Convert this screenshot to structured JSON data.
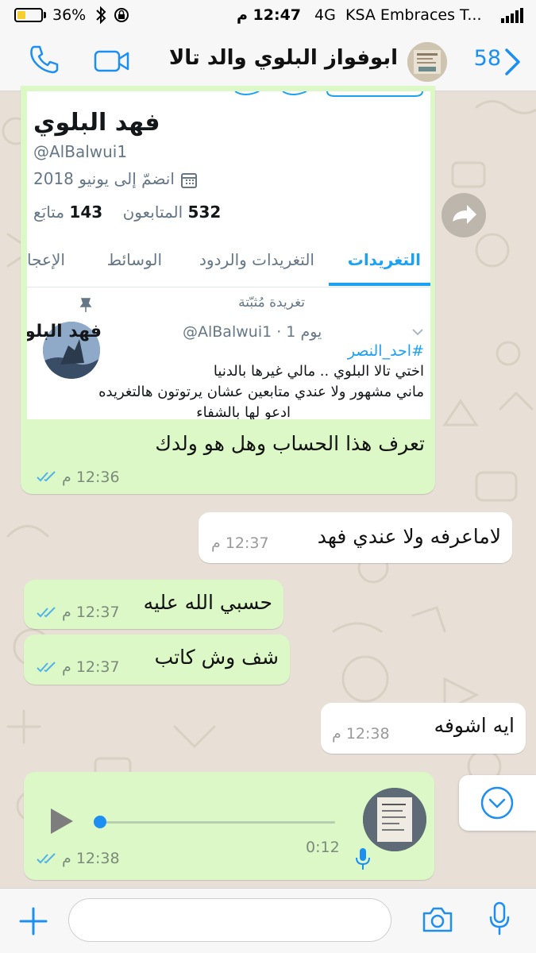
{
  "status_bar": {
    "battery_percent": "36%",
    "battery_level": 0.36,
    "time": "12:47 م",
    "network": "4G",
    "carrier": "KSA Embraces T..."
  },
  "header": {
    "unread_count": "58",
    "contact_name": "ابوفواز البلوي والد تالا"
  },
  "profile_card": {
    "name": "فهد البلوي",
    "handle": "@AlBalwui1",
    "joined": "انضمّ إلى يونيو 2018",
    "followers_count": "532",
    "followers_label": "المتابعون",
    "following_count": "143",
    "following_label": "متابَع",
    "tabs": [
      "التغريدات",
      "التغريدات والردود",
      "الوسائط",
      "الإعجا"
    ],
    "active_tab": 0,
    "pinned_label": "تغريدة مُثبّتة",
    "tweet": {
      "author": "فهد البلوي",
      "handle_time": "@AlBalwui1 · 1 يوم",
      "hashtag": "#احد_النصر",
      "line1": "اختي تالا البلوي .. مالي غيرها بالدنيا",
      "line2": "ماني مشهور ولا عندي متابعين عشان يرتوتون هالتغريده",
      "line3": "ادعو لها بالشفاء"
    }
  },
  "messages": [
    {
      "direction": "out",
      "text": "تعرف هذا الحساب وهل هو ولدك",
      "time": "12:36 م"
    },
    {
      "direction": "in",
      "text": "لاماعرفه ولا عندي فهد",
      "time": "12:37 م"
    },
    {
      "direction": "out",
      "text": "حسبي الله عليه",
      "time": "12:37 م"
    },
    {
      "direction": "out",
      "text": "شف وش كاتب",
      "time": "12:37 م"
    },
    {
      "direction": "in",
      "text": "ايه اشوفه",
      "time": "12:38 م"
    }
  ],
  "voice_note": {
    "duration": "0:12",
    "time": "12:38 م",
    "progress": 0.0
  },
  "colors": {
    "accent_blue": "#1d8ff2",
    "outgoing_bubble": "#dcf8c6",
    "incoming_bubble": "#ffffff",
    "read_ticks": "#4fb3e8",
    "twitter_blue": "#1da1f2"
  }
}
